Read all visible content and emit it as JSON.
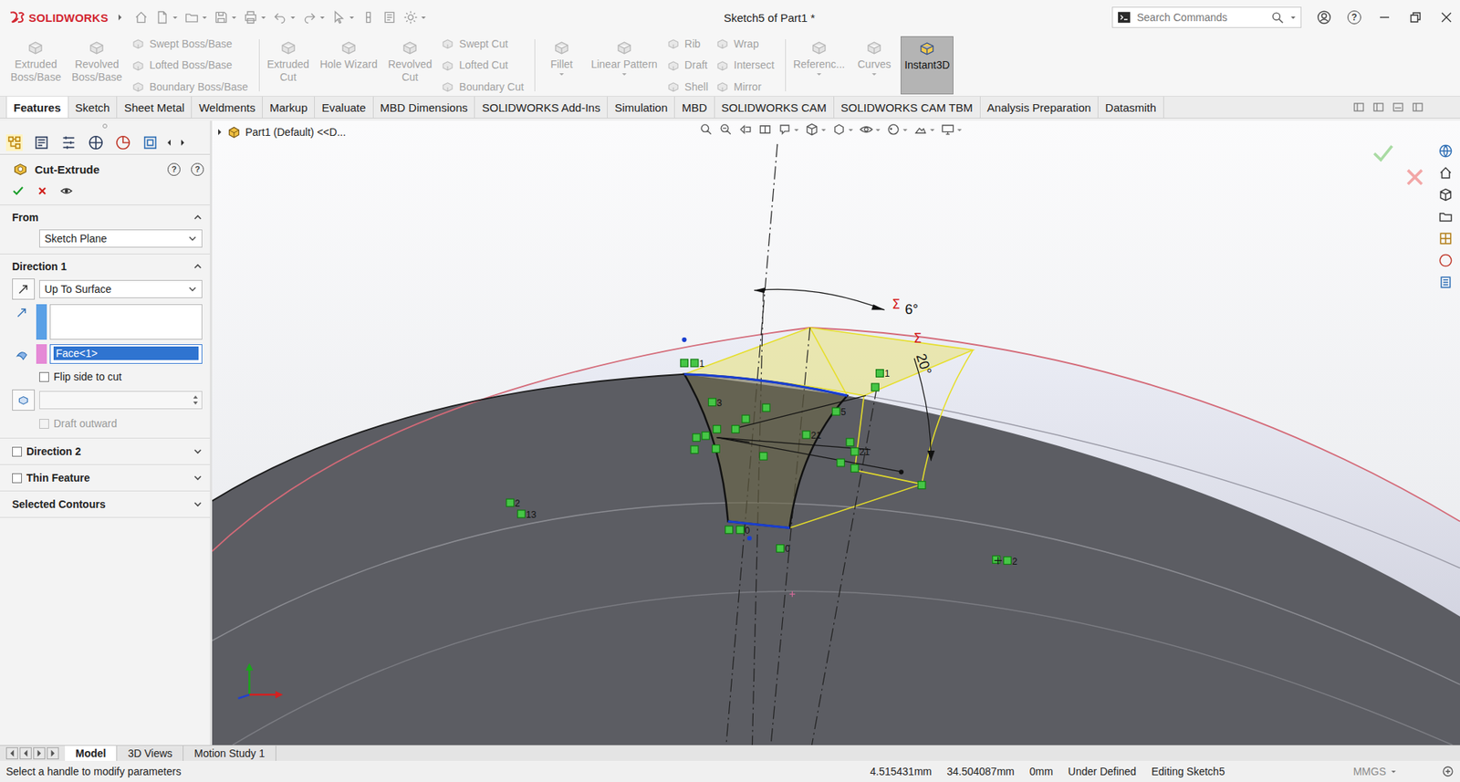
{
  "app": {
    "logo": "SOLIDWORKS",
    "title": "Sketch5 of Part1 *",
    "help_glyph": "?"
  },
  "search": {
    "placeholder": "Search Commands"
  },
  "ribbon": [
    [
      {
        "kind": "large",
        "lines": [
          "Extruded",
          "Boss/Base"
        ],
        "disabled": true,
        "selected": false,
        "dropdown": false
      },
      {
        "kind": "large",
        "lines": [
          "Revolved",
          "Boss/Base"
        ],
        "disabled": true,
        "selected": false,
        "dropdown": false
      },
      {
        "kind": "stack",
        "items": [
          {
            "label": "Swept Boss/Base",
            "disabled": true
          },
          {
            "label": "Lofted Boss/Base",
            "disabled": true
          },
          {
            "label": "Boundary Boss/Base",
            "disabled": true
          }
        ]
      }
    ],
    [
      {
        "kind": "large",
        "lines": [
          "Extruded",
          "Cut"
        ],
        "disabled": true,
        "selected": false,
        "dropdown": false
      },
      {
        "kind": "large",
        "lines": [
          "Hole Wizard"
        ],
        "disabled": true,
        "selected": false,
        "dropdown": false
      },
      {
        "kind": "large",
        "lines": [
          "Revolved",
          "Cut"
        ],
        "disabled": true,
        "selected": false,
        "dropdown": false
      },
      {
        "kind": "stack",
        "items": [
          {
            "label": "Swept Cut",
            "disabled": true
          },
          {
            "label": "Lofted Cut",
            "disabled": true
          },
          {
            "label": "Boundary Cut",
            "disabled": true
          }
        ]
      }
    ],
    [
      {
        "kind": "large",
        "lines": [
          "Fillet"
        ],
        "disabled": true,
        "selected": false,
        "dropdown": true
      },
      {
        "kind": "large",
        "lines": [
          "Linear Pattern"
        ],
        "disabled": true,
        "selected": false,
        "dropdown": true
      },
      {
        "kind": "stack",
        "items": [
          {
            "label": "Rib",
            "disabled": true
          },
          {
            "label": "Draft",
            "disabled": true
          },
          {
            "label": "Shell",
            "disabled": true
          }
        ]
      },
      {
        "kind": "stack",
        "items": [
          {
            "label": "Wrap",
            "disabled": true
          },
          {
            "label": "Intersect",
            "disabled": true
          },
          {
            "label": "Mirror",
            "disabled": true
          }
        ]
      }
    ],
    [
      {
        "kind": "large",
        "lines": [
          "Referenc..."
        ],
        "disabled": true,
        "selected": false,
        "dropdown": true
      },
      {
        "kind": "large",
        "lines": [
          "Curves"
        ],
        "disabled": true,
        "selected": false,
        "dropdown": true
      },
      {
        "kind": "large",
        "lines": [
          "Instant3D"
        ],
        "disabled": false,
        "selected": true,
        "dropdown": false
      }
    ]
  ],
  "tabs": [
    {
      "label": "Features",
      "selected": true
    },
    {
      "label": "Sketch",
      "selected": false
    },
    {
      "label": "Sheet Metal",
      "selected": false
    },
    {
      "label": "Weldments",
      "selected": false
    },
    {
      "label": "Markup",
      "selected": false
    },
    {
      "label": "Evaluate",
      "selected": false
    },
    {
      "label": "MBD Dimensions",
      "selected": false
    },
    {
      "label": "SOLIDWORKS Add-Ins",
      "selected": false
    },
    {
      "label": "Simulation",
      "selected": false
    },
    {
      "label": "MBD",
      "selected": false
    },
    {
      "label": "SOLIDWORKS CAM",
      "selected": false
    },
    {
      "label": "SOLIDWORKS CAM TBM",
      "selected": false
    },
    {
      "label": "Analysis Preparation",
      "selected": false
    },
    {
      "label": "Datasmith",
      "selected": false
    }
  ],
  "property_manager": {
    "title": "Cut-Extrude",
    "from": {
      "label": "From",
      "expanded": true,
      "value": "Sketch Plane"
    },
    "direction1": {
      "label": "Direction 1",
      "expanded": true,
      "end_condition": "Up To Surface",
      "direction_ref": "",
      "face_ref": "Face<1>",
      "face_ref_selected": true,
      "flip": {
        "label": "Flip side to cut",
        "checked": false,
        "disabled": false
      },
      "depth": "",
      "draft": {
        "label": "Draft outward",
        "checked": false,
        "disabled": true
      }
    },
    "collapsed_sections": [
      {
        "label": "Direction 2",
        "kind": "checkbox",
        "checked": false,
        "expanded": false
      },
      {
        "label": "Thin Feature",
        "kind": "checkbox",
        "checked": false,
        "expanded": false
      },
      {
        "label": "Selected Contours",
        "kind": "plain",
        "expanded": false
      }
    ]
  },
  "graphics": {
    "tree_flyout": "Part1 (Default) <<D...",
    "dimensions": [
      {
        "flag": "Σ",
        "value": "6°"
      },
      {
        "flag": "Σ",
        "value": "20°"
      }
    ],
    "relation_labels": [
      "1",
      "3",
      "1",
      "5",
      "21",
      "21",
      "2",
      "13",
      "0",
      "0",
      "2"
    ]
  },
  "bottom_tabs": [
    {
      "label": "Model",
      "selected": true
    },
    {
      "label": "3D Views",
      "selected": false
    },
    {
      "label": "Motion Study 1",
      "selected": false
    }
  ],
  "status_bar": {
    "message": "Select a handle to modify parameters",
    "fields": [
      "4.515431mm",
      "34.504087mm",
      "0mm",
      "Under Defined",
      "Editing Sketch5"
    ],
    "units": "MMGS"
  }
}
